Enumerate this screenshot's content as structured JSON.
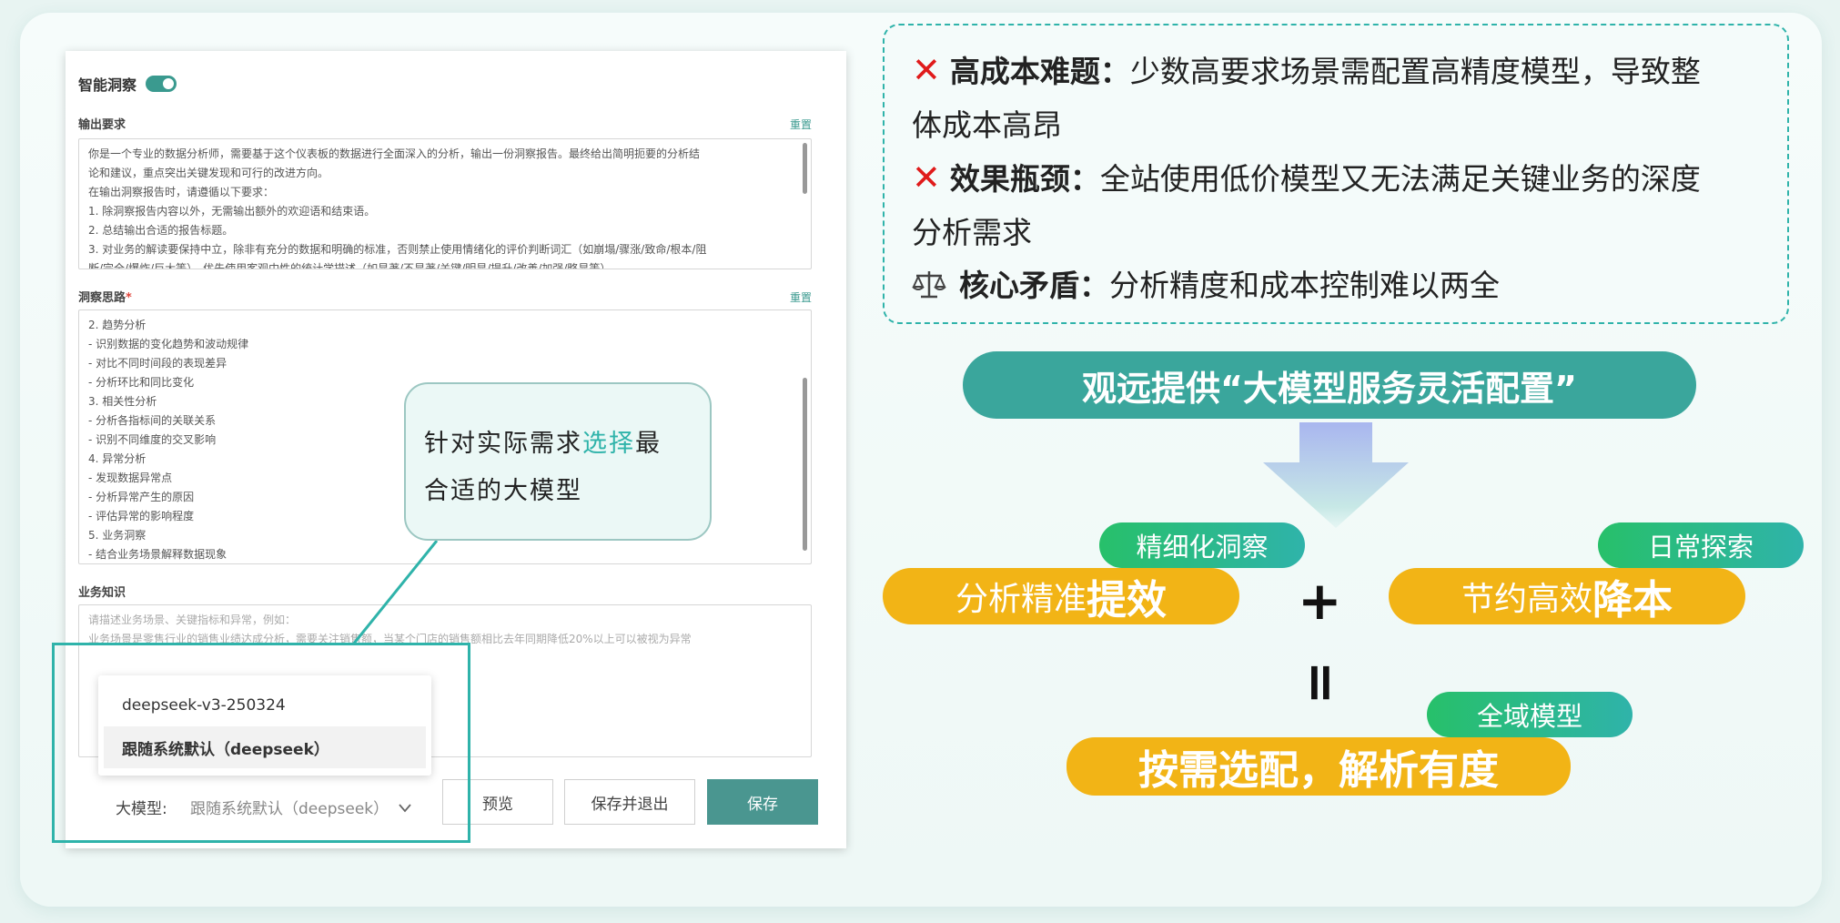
{
  "panel": {
    "title": "智能洞察",
    "output_req": {
      "label": "输出要求",
      "reset": "重置",
      "lines": [
        "你是一个专业的数据分析师，需要基于这个仪表板的数据进行全面深入的分析，输出一份洞察报告。最终给出简明扼要的分析结",
        "论和建议，重点突出关键发现和可行的改进方向。",
        "在输出洞察报告时，请遵循以下要求：",
        "1. 除洞察报告内容以外，无需输出额外的欢迎语和结束语。",
        "2. 总结输出合适的报告标题。",
        "3. 对业务的解读要保持中立，除非有充分的数据和明确的标准，否则禁止使用情绪化的评价判断词汇（如崩塌/骤涨/致命/根本/阻",
        "断/完全/爆炸/巨大等），优先使用客观中性的统计学描述（如显著/不显著/关键/明显/提升/改善/加强/略显等）"
      ]
    },
    "insight_idea": {
      "label": "洞察思路",
      "required_mark": "*",
      "reset": "重置",
      "lines": [
        "2. 趋势分析",
        "- 识别数据的变化趋势和波动规律",
        "- 对比不同时间段的表现差异",
        "- 分析环比和同比变化",
        "3. 相关性分析",
        "- 分析各指标间的关联关系",
        "- 识别不同维度的交叉影响",
        "4. 异常分析",
        "- 发现数据异常点",
        "- 分析异常产生的原因",
        "- 评估异常的影响程度",
        "5. 业务洞察",
        "- 结合业务场景解释数据现象"
      ]
    },
    "business_knowledge": {
      "label": "业务知识",
      "placeholder_lines": [
        "请描述业务场景、关键指标和异常，例如：",
        "业务场景是零售行业的销售业绩达成分析，需要关注销售额，当某个门店的销售额相比去年同期降低20%以上可以被视为异常"
      ]
    },
    "dropdown": {
      "options": [
        "deepseek-v3-250324",
        "跟随系统默认（deepseek）"
      ]
    },
    "bottom": {
      "model_label": "大模型:",
      "model_value": "跟随系统默认（deepseek）",
      "preview_label": "预览",
      "save_exit_label": "保存并退出",
      "save_label": "保存"
    },
    "accent_color": "#4a9690"
  },
  "callout": {
    "text_before": "针对实际需求",
    "text_accent": "选择",
    "text_after_1": "最",
    "text_line2": "合适的大模型"
  },
  "problems": [
    {
      "icon": "x-icon",
      "title": "高成本难题：",
      "text_1": "少数高要求场景需配置高精度模型，导致整",
      "text_2": "体成本高昂"
    },
    {
      "icon": "x-icon",
      "title": "效果瓶颈：",
      "text_1": "全站使用低价模型又无法满足关键业务的深度",
      "text_2": "分析需求"
    },
    {
      "icon": "scale-icon",
      "title": "核心矛盾：",
      "text_1": "分析精度和成本控制难以两全"
    }
  ],
  "x_mark": "✕",
  "banner": "观远提供“大模型服务灵活配置”",
  "equation": {
    "left": {
      "tag": "精细化洞察",
      "normal": "分析精准",
      "bold": "提效"
    },
    "plus": "+",
    "right": {
      "tag": "日常探索",
      "normal": "节约高效",
      "bold": "降本"
    },
    "equals": "=",
    "result": {
      "tag": "全域模型",
      "bold": "按需选配，解析有度"
    }
  },
  "colors": {
    "teal": "#2fb3aa",
    "banner": "#3aa69c",
    "yellow": "#f2b416",
    "green": "#27c06a",
    "red": "#e01b1b"
  }
}
